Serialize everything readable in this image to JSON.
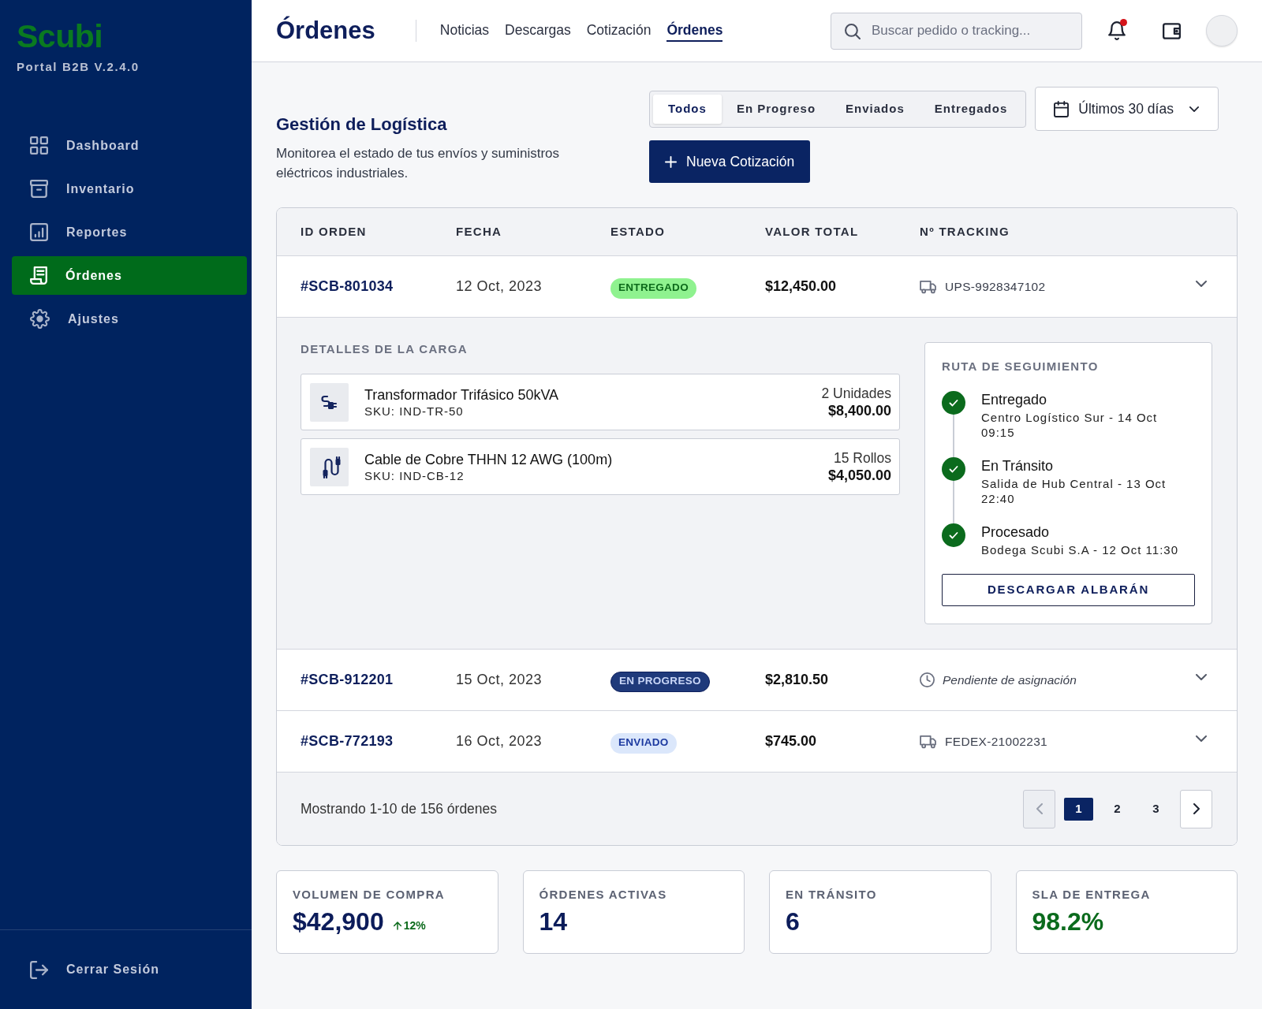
{
  "sidebar": {
    "logo": "Scubi",
    "version": "Portal B2B V.2.4.0",
    "items": [
      {
        "label": "Dashboard",
        "selected": false
      },
      {
        "label": "Inventario",
        "selected": false
      },
      {
        "label": "Reportes",
        "selected": false
      },
      {
        "label": "Órdenes",
        "selected": true
      },
      {
        "label": "Ajustes",
        "selected": false
      }
    ],
    "logout": "Cerrar Sesión"
  },
  "header": {
    "title": "Órdenes",
    "nav": [
      {
        "label": "Noticias",
        "selected": false
      },
      {
        "label": "Descargas",
        "selected": false
      },
      {
        "label": "Cotización",
        "selected": false
      },
      {
        "label": "Órdenes",
        "selected": true
      }
    ],
    "search": {
      "placeholder": "Buscar pedido o tracking..."
    },
    "notifications": {
      "unread": true
    }
  },
  "page": {
    "title": "Gestión de Logística",
    "description": "Monitorea el estado de tus envíos y suministros eléctricos industriales.",
    "filters": [
      {
        "label": "Todos",
        "selected": true
      },
      {
        "label": "En Progreso",
        "selected": false
      },
      {
        "label": "Enviados",
        "selected": false
      },
      {
        "label": "Entregados",
        "selected": false
      }
    ],
    "date_range": "Últimos 30 días",
    "new_button": "Nueva Cotización"
  },
  "orders": {
    "columns": [
      "ID ORDEN",
      "FECHA",
      "ESTADO",
      "VALOR TOTAL",
      "Nº TRACKING"
    ],
    "rows": [
      {
        "id": "#SCB-801034",
        "date": "12 Oct, 2023",
        "status": {
          "kind": "delivered",
          "label": "ENTREGADO"
        },
        "total": "$12,450.00",
        "tracking": {
          "kind": "carrier",
          "text": "UPS-9928347102"
        },
        "details": {
          "title": "DETALLES DE LA CARGA",
          "items": [
            {
              "name": "Transformador Trifásico 50kVA",
              "sku": "SKU: IND-TR-50",
              "quantity": "2 Unidades",
              "price": "$8,400.00"
            },
            {
              "name": "Cable de Cobre THHN 12 AWG (100m)",
              "sku": "SKU: IND-CB-12",
              "quantity": "15 Rollos",
              "price": "$4,050.00"
            }
          ],
          "route": {
            "title": "RUTA DE SEGUIMIENTO",
            "steps": [
              {
                "title": "Entregado",
                "detail": "Centro Logístico Sur - 14 Oct 09:15",
                "completed": true
              },
              {
                "title": "En Tránsito",
                "detail": "Salida de Hub Central - 13 Oct 22:40",
                "completed": true
              },
              {
                "title": "Procesado",
                "detail": "Bodega Scubi S.A - 12 Oct 11:30",
                "completed": true
              }
            ],
            "button": "DESCARGAR ALBARÁN"
          }
        }
      },
      {
        "id": "#SCB-912201",
        "date": "15 Oct, 2023",
        "status": {
          "kind": "progress",
          "label": "EN PROGRESO"
        },
        "total": "$2,810.50",
        "tracking": {
          "kind": "pending",
          "text": "Pendiente de asignación"
        }
      },
      {
        "id": "#SCB-772193",
        "date": "16 Oct, 2023",
        "status": {
          "kind": "shipped",
          "label": "ENVIADO"
        },
        "total": "$745.00",
        "tracking": {
          "kind": "carrier",
          "text": "FEDEX-21002231"
        }
      }
    ],
    "summary": "Mostrando 1-10 de 156 órdenes",
    "pagination": {
      "previous_disabled": true,
      "next_disabled": false,
      "pages": [
        {
          "label": "1",
          "selected": true
        },
        {
          "label": "2",
          "selected": false
        },
        {
          "label": "3",
          "selected": false
        }
      ]
    }
  },
  "stats": [
    {
      "label": "VOLUMEN DE COMPRA",
      "value": "$42,900",
      "trend": "12%",
      "color": "#0c1c5a"
    },
    {
      "label": "ÓRDENES ACTIVAS",
      "value": "14",
      "color": "#0c1c5a"
    },
    {
      "label": "EN TRÁNSITO",
      "value": "6",
      "color": "#0c1c5a"
    },
    {
      "label": "SLA DE ENTREGA",
      "value": "98.2%",
      "color": "#0b6b1d"
    }
  ]
}
